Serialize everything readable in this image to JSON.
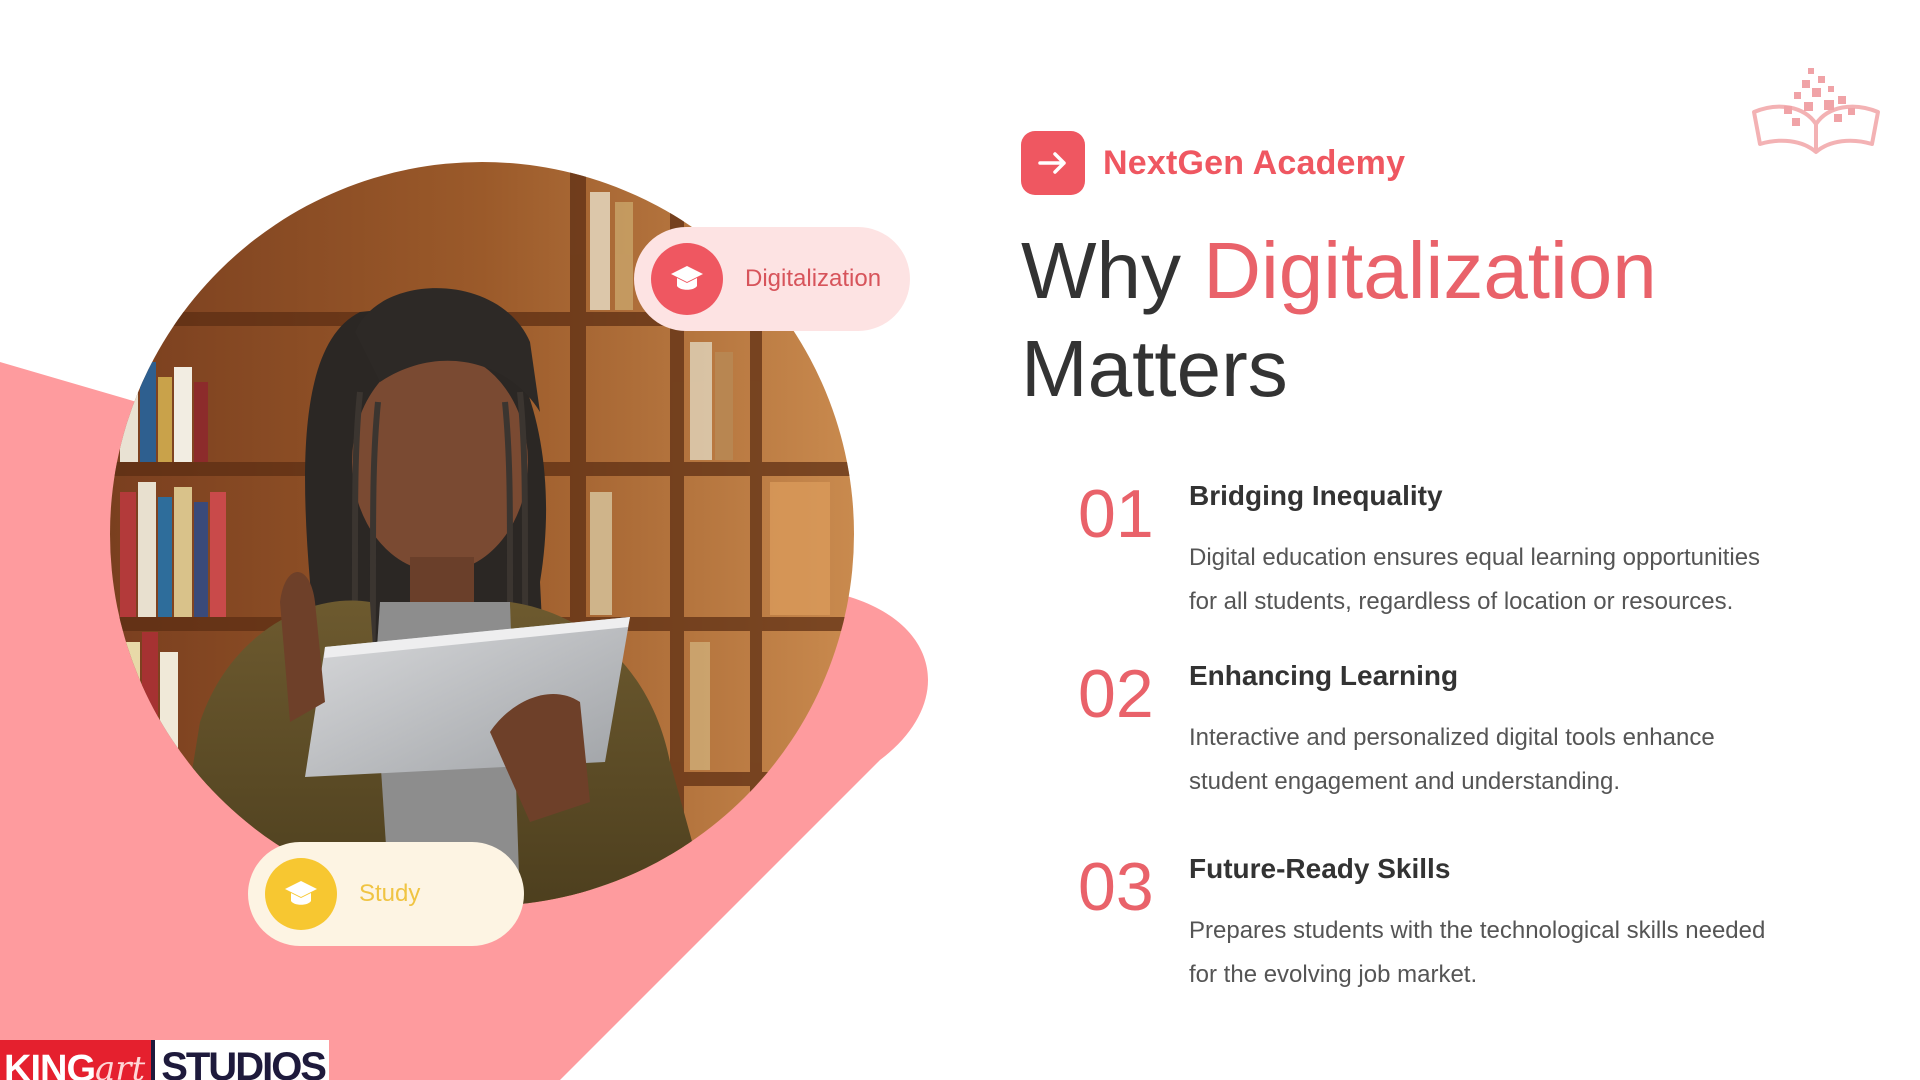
{
  "brand": {
    "name": "NextGen Academy",
    "icon": "arrow-right-icon",
    "color": "#ef5761"
  },
  "headline": {
    "prefix": "Why",
    "accent": "Digitalization",
    "suffix": "Matters",
    "accent_color": "#e9626a"
  },
  "tags": {
    "digitalization": {
      "label": "Digitalization",
      "icon": "graduation-cap-icon",
      "color": "#ef5761"
    },
    "study": {
      "label": "Study",
      "icon": "graduation-cap-icon",
      "color": "#f7c731"
    }
  },
  "points": [
    {
      "number": "01",
      "title": "Bridging Inequality",
      "text": "Digital education ensures equal learning opportunities for all students, regardless of location or resources."
    },
    {
      "number": "02",
      "title": "Enhancing Learning",
      "text": "Interactive and personalized digital tools enhance student engagement and understanding."
    },
    {
      "number": "03",
      "title": "Future-Ready Skills",
      "text": "Prepares students with the technological skills needed for the evolving job market."
    }
  ],
  "decor": {
    "logo": "open-book-pixel-icon",
    "photo": "student-with-tablet-in-library",
    "blob_color": "#fe9b9e"
  },
  "watermark": {
    "king": "KING",
    "art": "art",
    "studios": "STUDIOS"
  }
}
